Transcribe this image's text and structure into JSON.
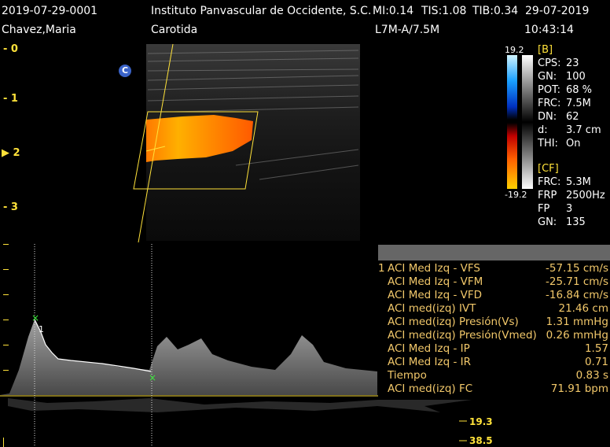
{
  "header": {
    "exam_id": "2019-07-29-0001",
    "institution": "Instituto Panvascular de Occidente, S.C.",
    "mi": "MI:0.14",
    "tis": "TIS:1.08",
    "tib": "TIB:0.34",
    "date": "29-07-2019",
    "patient": "Chavez,Maria",
    "exam_type": "Carotida",
    "probe": "L7M-A/7.5M",
    "time": "10:43:14"
  },
  "depth_scale": [
    "0",
    "1",
    "2",
    "3"
  ],
  "colors": {
    "accent": "#ffe23a",
    "measure_text": "#f2c86a",
    "badge": "#3a63c8"
  },
  "color_bar": {
    "max": "19.2",
    "min": "-19.2"
  },
  "b_mode": {
    "title": "[B]",
    "params": [
      {
        "label": "CPS:",
        "value": "23"
      },
      {
        "label": "GN:",
        "value": "100"
      },
      {
        "label": "POT:",
        "value": "68 %"
      },
      {
        "label": "FRC:",
        "value": "7.5M"
      },
      {
        "label": "DN:",
        "value": "62"
      },
      {
        "label": "d:",
        "value": "3.7 cm"
      },
      {
        "label": "THI:",
        "value": "On"
      }
    ]
  },
  "cf_mode": {
    "title": "[CF]",
    "params": [
      {
        "label": "FRC:",
        "value": "5.3M"
      },
      {
        "label": "FRP",
        "value": "2500Hz"
      },
      {
        "label": "FP",
        "value": "3"
      },
      {
        "label": "GN:",
        "value": "135"
      }
    ]
  },
  "badge_c": "C",
  "cursor_marker": "1",
  "measurements": [
    {
      "idx": "1",
      "label": "ACI Med Izq - VFS",
      "value": "-57.15 cm/s"
    },
    {
      "idx": "",
      "label": "ACI Med Izq - VFM",
      "value": "-25.71 cm/s"
    },
    {
      "idx": "",
      "label": "ACI Med Izq - VFD",
      "value": "-16.84 cm/s"
    },
    {
      "idx": "",
      "label": "ACI med(izq) IVT",
      "value": "21.46 cm"
    },
    {
      "idx": "",
      "label": "ACI med(izq) Presión(Vs)",
      "value": "1.31 mmHg"
    },
    {
      "idx": "",
      "label": "ACI med(izq) Presión(Vmed)",
      "value": "0.26 mmHg"
    },
    {
      "idx": "",
      "label": "ACI Med Izq - IP",
      "value": "1.57"
    },
    {
      "idx": "",
      "label": "ACI Med Izq - IR",
      "value": "0.71"
    },
    {
      "idx": "",
      "label": "Tiempo",
      "value": "0.83 s"
    },
    {
      "idx": "",
      "label": "ACI med(izq) FC",
      "value": "71.91 bpm"
    }
  ],
  "velocity_scale": [
    "19.3",
    "38.5"
  ]
}
